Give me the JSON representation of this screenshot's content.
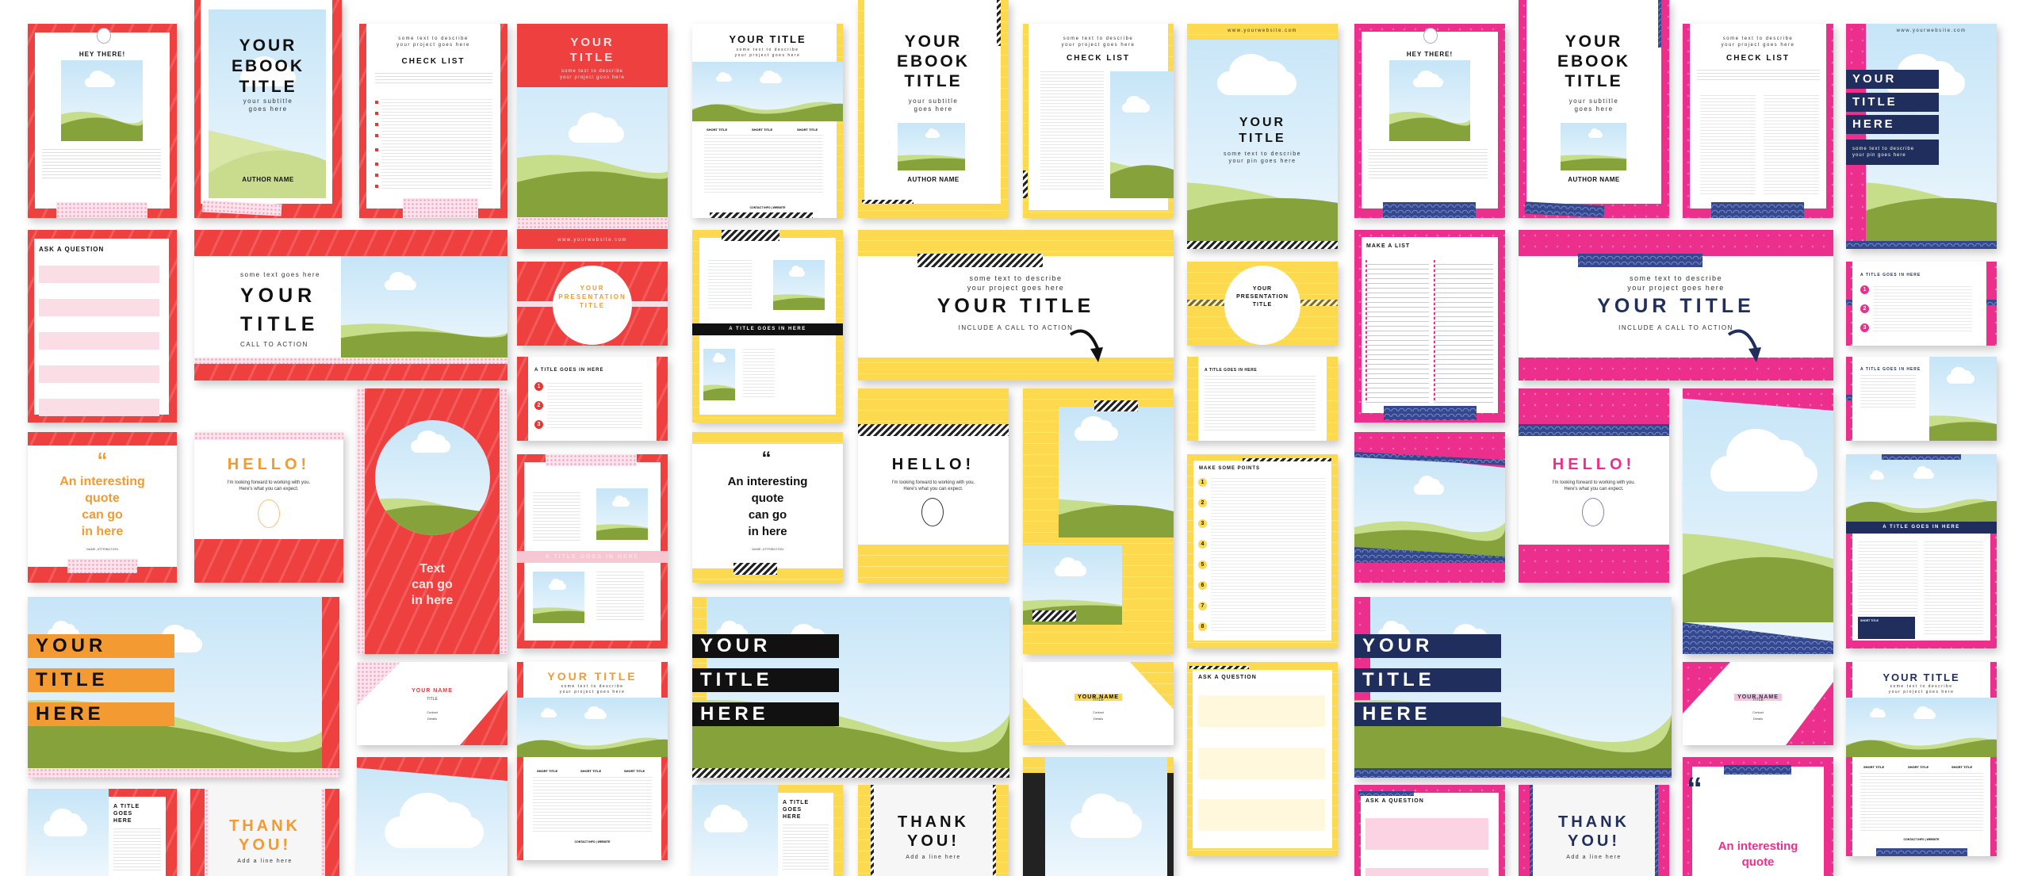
{
  "collage": {
    "themes": [
      {
        "name": "red",
        "accent": "#ef4040",
        "secondary": "#f39a32",
        "pattern": "zebra-stripes + pink dots"
      },
      {
        "name": "yellow",
        "accent": "#fcd94e",
        "secondary": "#111111",
        "pattern": "lines + black-white stripes"
      },
      {
        "name": "pink",
        "accent": "#ec2f8c",
        "secondary": "#1f2e5c",
        "pattern": "dots + navy waves"
      }
    ]
  },
  "text": {
    "hey_there": "HEY THERE!",
    "ebook_title": "YOUR EBOOK TITLE",
    "ebook_title_l1": "YOUR",
    "ebook_title_l2": "EBOOK",
    "ebook_title_l3": "TITLE",
    "ebook_sub_l1": "your subtitle",
    "ebook_sub_l2": "goes here",
    "author": "AUTHOR NAME",
    "describe_l1": "some text to describe",
    "describe_l2": "your project goes here",
    "check_list": "CHECK LIST",
    "check_intro": "Intro or explainer text for your check list can go in here. Chupa chups caramels donut powder jelly-o. Gummi bears gummies chocolate cake. Lollipop halvah wafer candy canes topping apple pie chocolate bar.",
    "your": "YOUR",
    "title": "TITLE",
    "here": "HERE",
    "your_title": "YOUR TITLE",
    "website": "www.yourwebsite.com",
    "ask_question": "ASK A QUESTION",
    "some_text_goes_here": "some text goes here",
    "call_to_action": "CALL TO ACTION",
    "include_cta": "INCLUDE A CALL TO ACTION",
    "pres_l1": "YOUR",
    "pres_l2": "PRESENTATION",
    "pres_l3": "TITLE",
    "title_goes_in_here": "A TITLE GOES IN HERE",
    "quote_mark": "“",
    "quote_l1": "An interesting",
    "quote_l2": "quote",
    "quote_l3": "can go",
    "quote_l4": "in here",
    "attribution": "NAME, ATTRIBUTION",
    "hello": "HELLO!",
    "hello_l1": "I'm looking forward to working with you.",
    "hello_l2": "Here's what you can expect.",
    "text_can_go_l1": "Text",
    "text_can_go_l2": "can go",
    "text_can_go_l3": "in here",
    "your_name": "YOUR NAME",
    "name_title": "TITLE",
    "contact": "Contact",
    "details": "Details",
    "a_title_l1": "A TITLE",
    "a_title_l2": "GOES",
    "a_title_l3": "HERE",
    "thank_l1": "THANK",
    "thank_l2": "YOU!",
    "add_line": "Add a line here",
    "short_title": "SHORT TITLE",
    "contact_website": "CONTACT INFO | WEBSITE",
    "make_points": "MAKE SOME POINTS",
    "make_list": "MAKE A LIST",
    "pin_l1": "some text to describe",
    "pin_l2": "your pin goes here",
    "filler": "Candy canes brownie macaroon sweet roll marshmallow danish cake chocolate cake. Oat cake croissant cake cookie biscuit. Icing jelly beans donut wafer.",
    "intro_text": "Here's some space where you can introduce yourself and your business to your new friends."
  },
  "numbers": {
    "red_points": [
      "1",
      "2",
      "3"
    ],
    "yellow_points": [
      "1",
      "2",
      "3",
      "4",
      "5",
      "6",
      "7",
      "8"
    ],
    "pink_points": [
      "1",
      "2",
      "3"
    ]
  }
}
